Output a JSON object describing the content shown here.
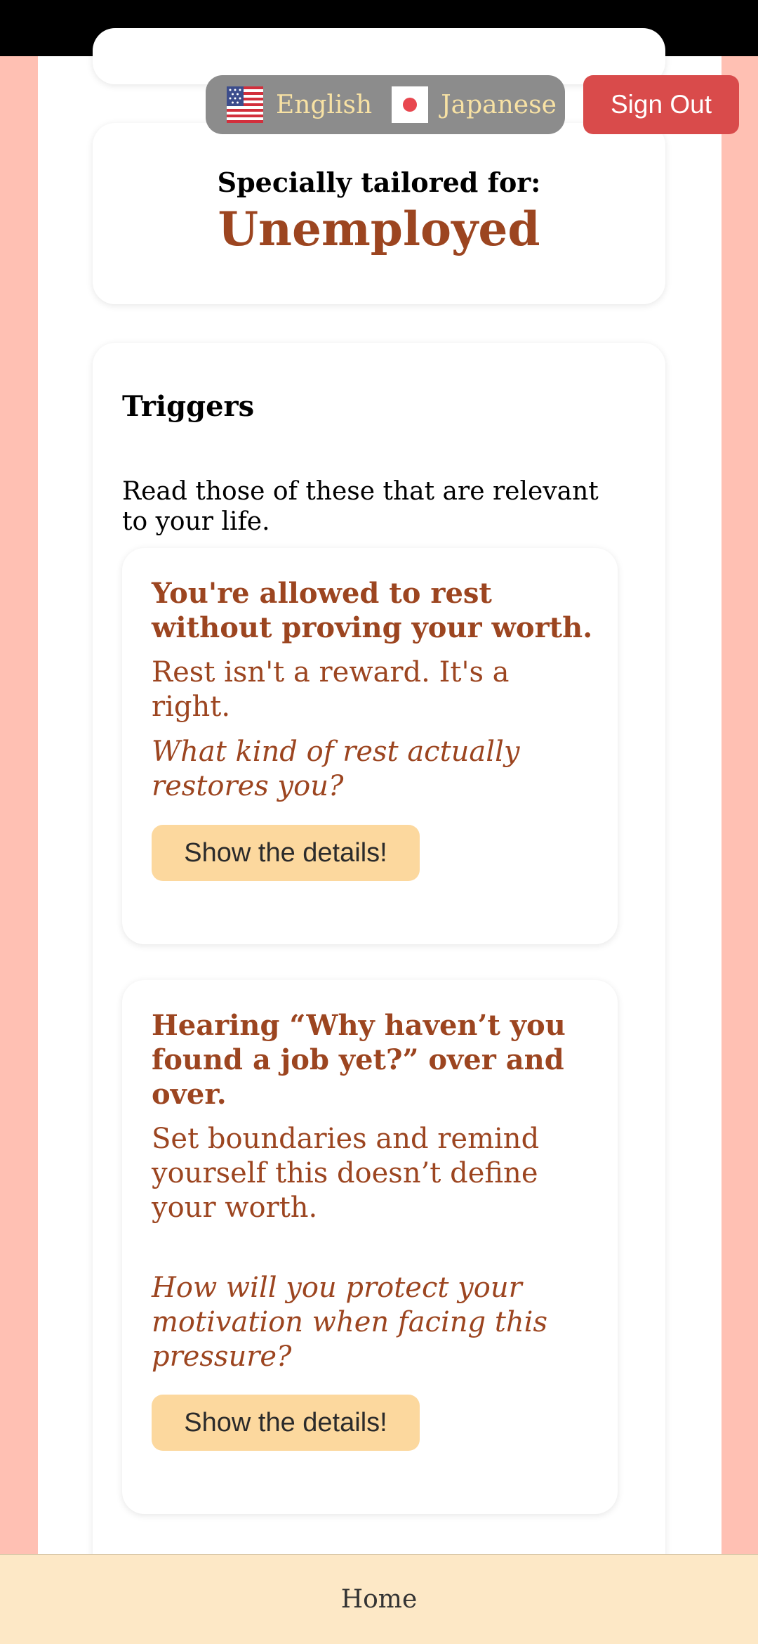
{
  "language_switcher": {
    "options": [
      {
        "label": "English",
        "icon": "us-flag-icon"
      },
      {
        "label": "Japanese",
        "icon": "japan-flag-icon"
      }
    ]
  },
  "header": {
    "sign_out_label": "Sign Out"
  },
  "tailored": {
    "heading": "Specially tailored for:",
    "value": "Unemployed"
  },
  "triggers": {
    "title": "Triggers",
    "intro": "Read those of these that are relevant to your life.",
    "items": [
      {
        "title": "You're allowed to rest without proving your worth.",
        "body": "Rest isn't a reward. It's a right.",
        "question": "What kind of rest actually restores you?",
        "button_label": "Show the details!"
      },
      {
        "title": "Hearing “Why haven’t you found a job yet?” over and over.",
        "body": "Set boundaries and remind yourself this doesn’t define your worth.",
        "question": "How will you protect your motivation when facing this pressure?",
        "button_label": "Show the details!"
      }
    ]
  },
  "bottom_nav": {
    "home_label": "Home"
  },
  "colors": {
    "background": "#ffc0b3",
    "accent": "#9c4520",
    "sign_out": "#d94b4b",
    "details_button": "#fcd89e",
    "language_text": "#f8e2a4",
    "nav_background": "#fde8c6"
  }
}
